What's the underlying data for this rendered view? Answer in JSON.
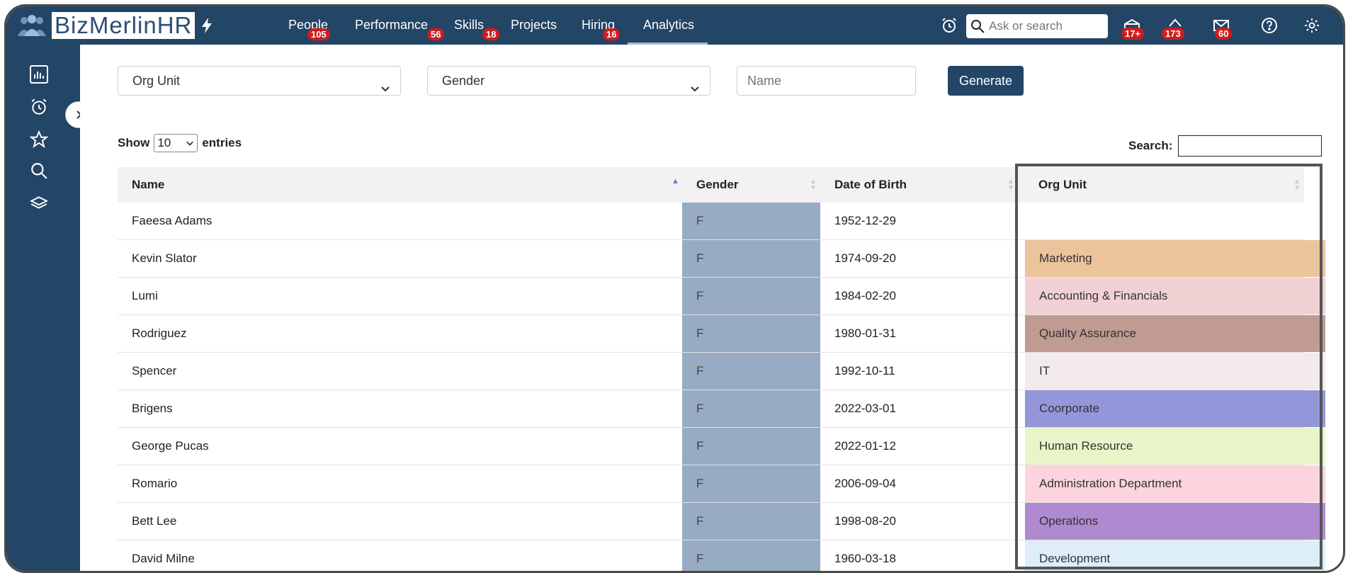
{
  "app": {
    "title": "BizMerlinHR"
  },
  "nav": [
    {
      "label": "People",
      "badge": "105"
    },
    {
      "label": "Performance",
      "badge": "56"
    },
    {
      "label": "Skills",
      "badge": "18"
    },
    {
      "label": "Projects",
      "badge": ""
    },
    {
      "label": "Hiring",
      "badge": "16"
    },
    {
      "label": "Analytics",
      "badge": "",
      "active": true
    }
  ],
  "topbar": {
    "search_placeholder": "Ask or search",
    "badges": {
      "inbox": "17+",
      "notifications": "173",
      "messages": "60"
    }
  },
  "filters": {
    "org_unit": "Org Unit",
    "gender": "Gender",
    "name_placeholder": "Name",
    "generate": "Generate"
  },
  "table_controls": {
    "show": "Show",
    "entries_value": "10",
    "entries": "entries",
    "search_label": "Search:"
  },
  "table": {
    "headers": [
      "Name",
      "Gender",
      "Date of Birth",
      "Org Unit"
    ],
    "rows": [
      {
        "name": "Faeesa Adams",
        "gender": "F",
        "dob": "1952-12-29",
        "org": "",
        "org_color": "#ffffff"
      },
      {
        "name": "Kevin Slator",
        "gender": "F",
        "dob": "1974-09-20",
        "org": "Marketing",
        "org_color": "#ecc49c"
      },
      {
        "name": "Lumi",
        "gender": "F",
        "dob": "1984-02-20",
        "org": "Accounting & Financials",
        "org_color": "#f2d1d5"
      },
      {
        "name": "Rodriguez",
        "gender": "F",
        "dob": "1980-01-31",
        "org": "Quality Assurance",
        "org_color": "#bf9b94"
      },
      {
        "name": "Spencer",
        "gender": "F",
        "dob": "1992-10-11",
        "org": "IT",
        "org_color": "#f3ebeb"
      },
      {
        "name": "Brigens",
        "gender": "F",
        "dob": "2022-03-01",
        "org": "Coorporate",
        "org_color": "#9397d9"
      },
      {
        "name": "George Pucas",
        "gender": "F",
        "dob": "2022-01-12",
        "org": "Human Resource",
        "org_color": "#e9f5c8"
      },
      {
        "name": "Romario",
        "gender": "F",
        "dob": "2006-09-04",
        "org": "Administration Department",
        "org_color": "#fbd4de"
      },
      {
        "name": "Bett Lee",
        "gender": "F",
        "dob": "1998-08-20",
        "org": "Operations",
        "org_color": "#b08ad0"
      },
      {
        "name": "David Milne",
        "gender": "F",
        "dob": "1960-03-18",
        "org": "Development",
        "org_color": "#ddeef8"
      }
    ]
  },
  "colors": {
    "navy": "#234566",
    "gender_cell": "#97abc3",
    "badge": "#d01c1c"
  }
}
